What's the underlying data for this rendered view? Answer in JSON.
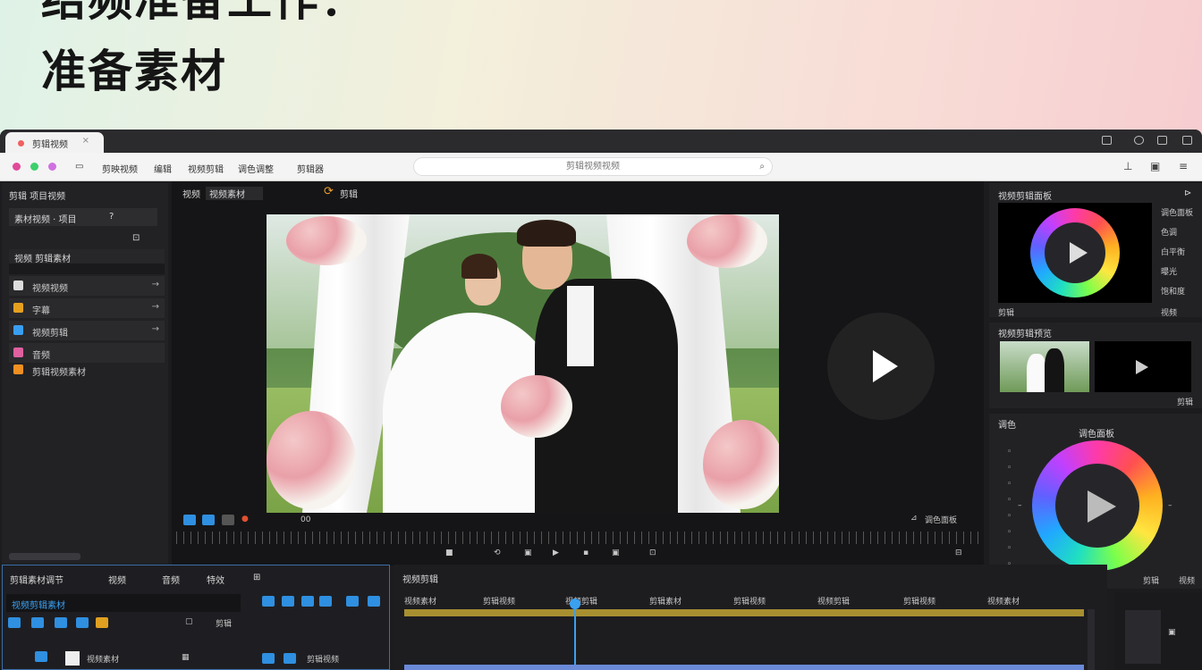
{
  "headline": {
    "line1": "结频准备工作：",
    "line2": "准备素材"
  },
  "tab": {
    "title": "剪辑视频"
  },
  "menu": [
    "剪映视频",
    "编辑",
    "视频剪辑",
    "调色调整",
    "剪辑器"
  ],
  "address": {
    "text": "剪辑视频视频"
  },
  "left_panel": {
    "title": "剪辑 项目视频",
    "sub": "素材视频 · 项目",
    "row_header": "视频 剪辑素材",
    "items": [
      {
        "label": "视频视频",
        "icon_color": "#dddddd"
      },
      {
        "label": "字幕",
        "icon_color": "#e6a020"
      },
      {
        "label": "视频剪辑",
        "icon_color": "#3a9ef0"
      },
      {
        "label": "音频",
        "icon_color": "#e060a0"
      },
      {
        "label": "剪辑视频素材",
        "icon_color": "#f09020"
      }
    ]
  },
  "viewer": {
    "tab1": "视频",
    "tab2": "视频素材",
    "mode": "剪辑",
    "bottom_right": "调色面板",
    "tc": "00"
  },
  "right_panel": {
    "section1": "视频剪辑面板",
    "section1_items": [
      "调色面板",
      "色调",
      "白平衡",
      "曝光",
      "饱和度"
    ],
    "section1_bottom": "剪辑",
    "section1_right": "视频",
    "section2": "视频剪辑预览",
    "section2_bottom": "剪辑",
    "section3": "调色",
    "section3_sub": "调色面板",
    "section3_bottom": "剪辑",
    "section3_right": "视频"
  },
  "bottom_left": {
    "tabs": [
      "剪辑素材调节",
      "视频",
      "音频",
      "特效"
    ],
    "field": "视频剪辑素材",
    "label": "剪辑",
    "bottom_label": "视频素材",
    "bottom_label2": "剪辑视频"
  },
  "timeline": {
    "title": "视频剪辑",
    "labels": [
      "视频素材",
      "剪辑视频",
      "视频剪辑",
      "剪辑素材",
      "剪辑视频",
      "视频剪辑",
      "剪辑视频",
      "视频素材"
    ]
  },
  "colors": {
    "accent": "#2f8fe0",
    "ring_center": "#26262a"
  }
}
